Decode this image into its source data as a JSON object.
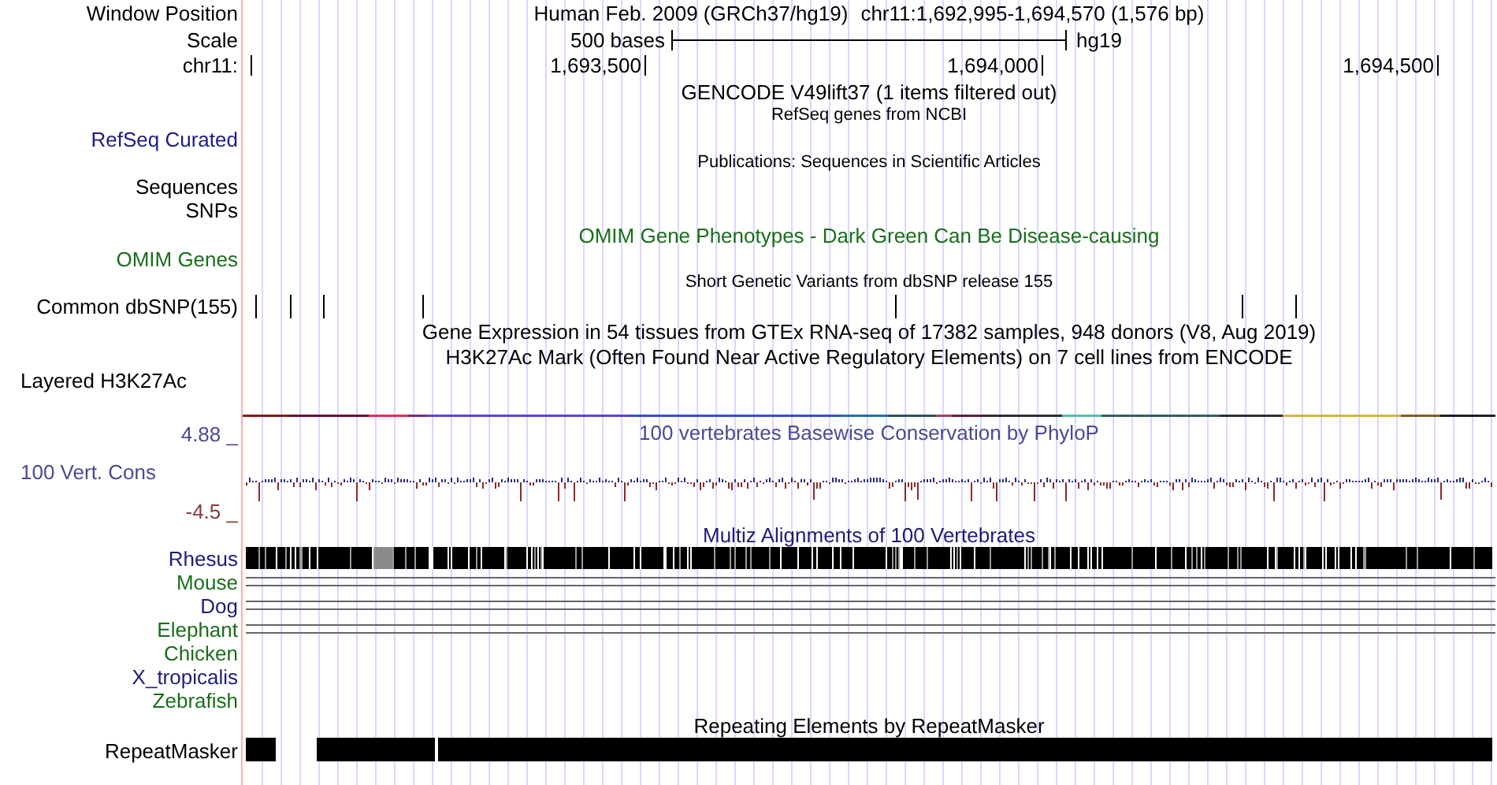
{
  "header": {
    "label": "Window Position",
    "assembly": "Human Feb. 2009 (GRCh37/hg19)",
    "position": "chr11:1,692,995-1,694,570 (1,576 bp)"
  },
  "scale": {
    "label": "Scale",
    "length": "500 bases",
    "assembly": "hg19"
  },
  "ruler": {
    "label": "chr11:",
    "ticks": [
      "1,693,500",
      "1,694,000",
      "1,694,500"
    ]
  },
  "rows": [
    {
      "kind": "title",
      "text": "GENCODE V49lift37 (1 items filtered out)",
      "color": "#000000"
    },
    {
      "kind": "small_title",
      "text": "RefSeq genes from NCBI",
      "color": "#000000"
    },
    {
      "kind": "label",
      "label": "RefSeq Curated",
      "color": "#1c1c8a"
    },
    {
      "kind": "small_title",
      "text": "Publications: Sequences in Scientific Articles",
      "color": "#000000"
    },
    {
      "kind": "label",
      "label": "Sequences",
      "color": "#000000"
    },
    {
      "kind": "label",
      "label": "SNPs",
      "color": "#000000"
    },
    {
      "kind": "title",
      "text": "OMIM Gene Phenotypes - Dark Green Can Be Disease-causing",
      "color": "#1a6e1a"
    },
    {
      "kind": "label",
      "label": "OMIM Genes",
      "color": "#1a6e1a"
    },
    {
      "kind": "small_title",
      "text": "Short Genetic Variants from dbSNP release 155",
      "color": "#000000"
    },
    {
      "kind": "snp",
      "label": "Common dbSNP(155)",
      "color": "#000000"
    },
    {
      "kind": "title",
      "text": "Gene Expression in 54 tissues from GTEx RNA-seq of 17382 samples, 948 donors (V8, Aug 2019)",
      "color": "#000000"
    },
    {
      "kind": "title",
      "text": "H3K27Ac Mark (Often Found Near Active Regulatory Elements) on 7 cell lines from ENCODE",
      "color": "#000000"
    },
    {
      "kind": "group_label",
      "label": "Layered H3K27Ac",
      "color": "#000000"
    },
    {
      "kind": "signal"
    },
    {
      "kind": "conservation",
      "label": "100 Vert. Cons",
      "color": "#4a4a96",
      "max": {
        "text": "4.88 _",
        "color": "#4a4a96"
      },
      "min": {
        "text": "-4.5 _",
        "color": "#8b3a3a"
      },
      "title": {
        "text": "100 vertebrates Basewise Conservation by PhyloP",
        "color": "#4a4a96"
      }
    },
    {
      "kind": "title",
      "text": "Multiz Alignments of 100 Vertebrates",
      "color": "#1c1c7a"
    },
    {
      "kind": "species_bar",
      "label": "Rhesus",
      "color": "#1c1c7a"
    },
    {
      "kind": "species_lines",
      "label": "Mouse",
      "color": "#1a6e1a"
    },
    {
      "kind": "species_lines",
      "label": "Dog",
      "color": "#1c1c7a"
    },
    {
      "kind": "species_lines",
      "label": "Elephant",
      "color": "#1a6e1a"
    },
    {
      "kind": "species_empty",
      "label": "Chicken",
      "color": "#1a6e1a"
    },
    {
      "kind": "species_empty",
      "label": "X_tropicalis",
      "color": "#1c1c7a"
    },
    {
      "kind": "species_empty",
      "label": "Zebrafish",
      "color": "#1a6e1a"
    },
    {
      "kind": "title",
      "text": "Repeating Elements by RepeatMasker",
      "color": "#000000"
    },
    {
      "kind": "repeat",
      "label": "RepeatMasker",
      "color": "#000000"
    }
  ]
}
